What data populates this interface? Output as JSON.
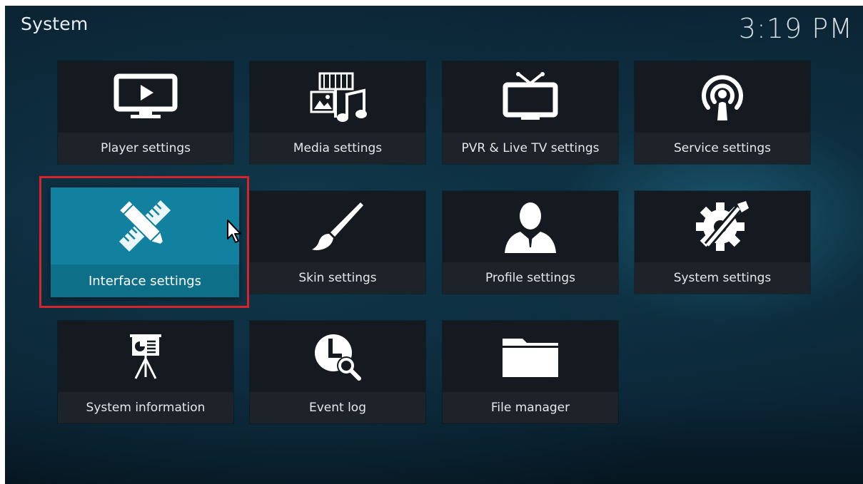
{
  "header": {
    "title": "System",
    "clock": "3:19 PM"
  },
  "tiles": [
    {
      "label": "Player settings",
      "icon": "monitor-play-icon"
    },
    {
      "label": "Media settings",
      "icon": "media-film-music-icon"
    },
    {
      "label": "PVR & Live TV settings",
      "icon": "tv-antenna-icon"
    },
    {
      "label": "Service settings",
      "icon": "broadcast-podcast-icon"
    },
    {
      "label": "Interface settings",
      "icon": "pencil-ruler-icon",
      "focused": true
    },
    {
      "label": "Skin settings",
      "icon": "paintbrush-icon"
    },
    {
      "label": "Profile settings",
      "icon": "user-profile-icon"
    },
    {
      "label": "System settings",
      "icon": "gear-wrench-icon"
    },
    {
      "label": "System information",
      "icon": "presentation-easel-icon"
    },
    {
      "label": "Event log",
      "icon": "clock-search-icon"
    },
    {
      "label": "File manager",
      "icon": "folder-icon"
    }
  ],
  "colors": {
    "focus_accent": "#12819f",
    "highlight_border": "#d8232a",
    "tile_background": "#141a1f"
  }
}
